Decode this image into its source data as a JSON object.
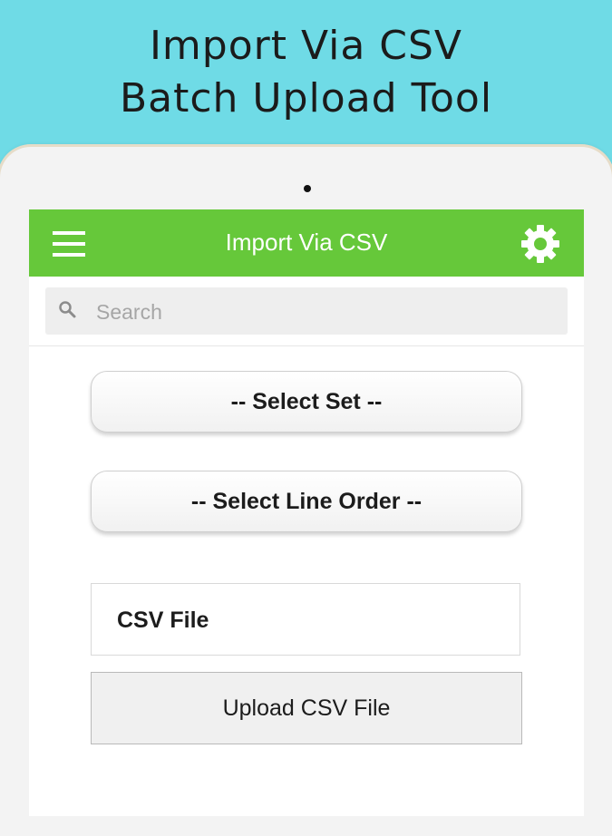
{
  "promo": {
    "line1": "Import Via CSV",
    "line2": "Batch Upload Tool"
  },
  "appbar": {
    "title": "Import Via CSV",
    "menu_icon": "hamburger-menu-icon",
    "settings_icon": "gear-icon",
    "color": "#66c83a"
  },
  "search": {
    "placeholder": "Search",
    "icon": "search-icon"
  },
  "form": {
    "select_set_label": "-- Select Set --",
    "select_line_order_label": "-- Select Line Order --",
    "csv_file_label": "CSV File",
    "upload_button_label": "Upload CSV File"
  },
  "colors": {
    "background": "#6fdbe6",
    "accent": "#66c83a"
  }
}
